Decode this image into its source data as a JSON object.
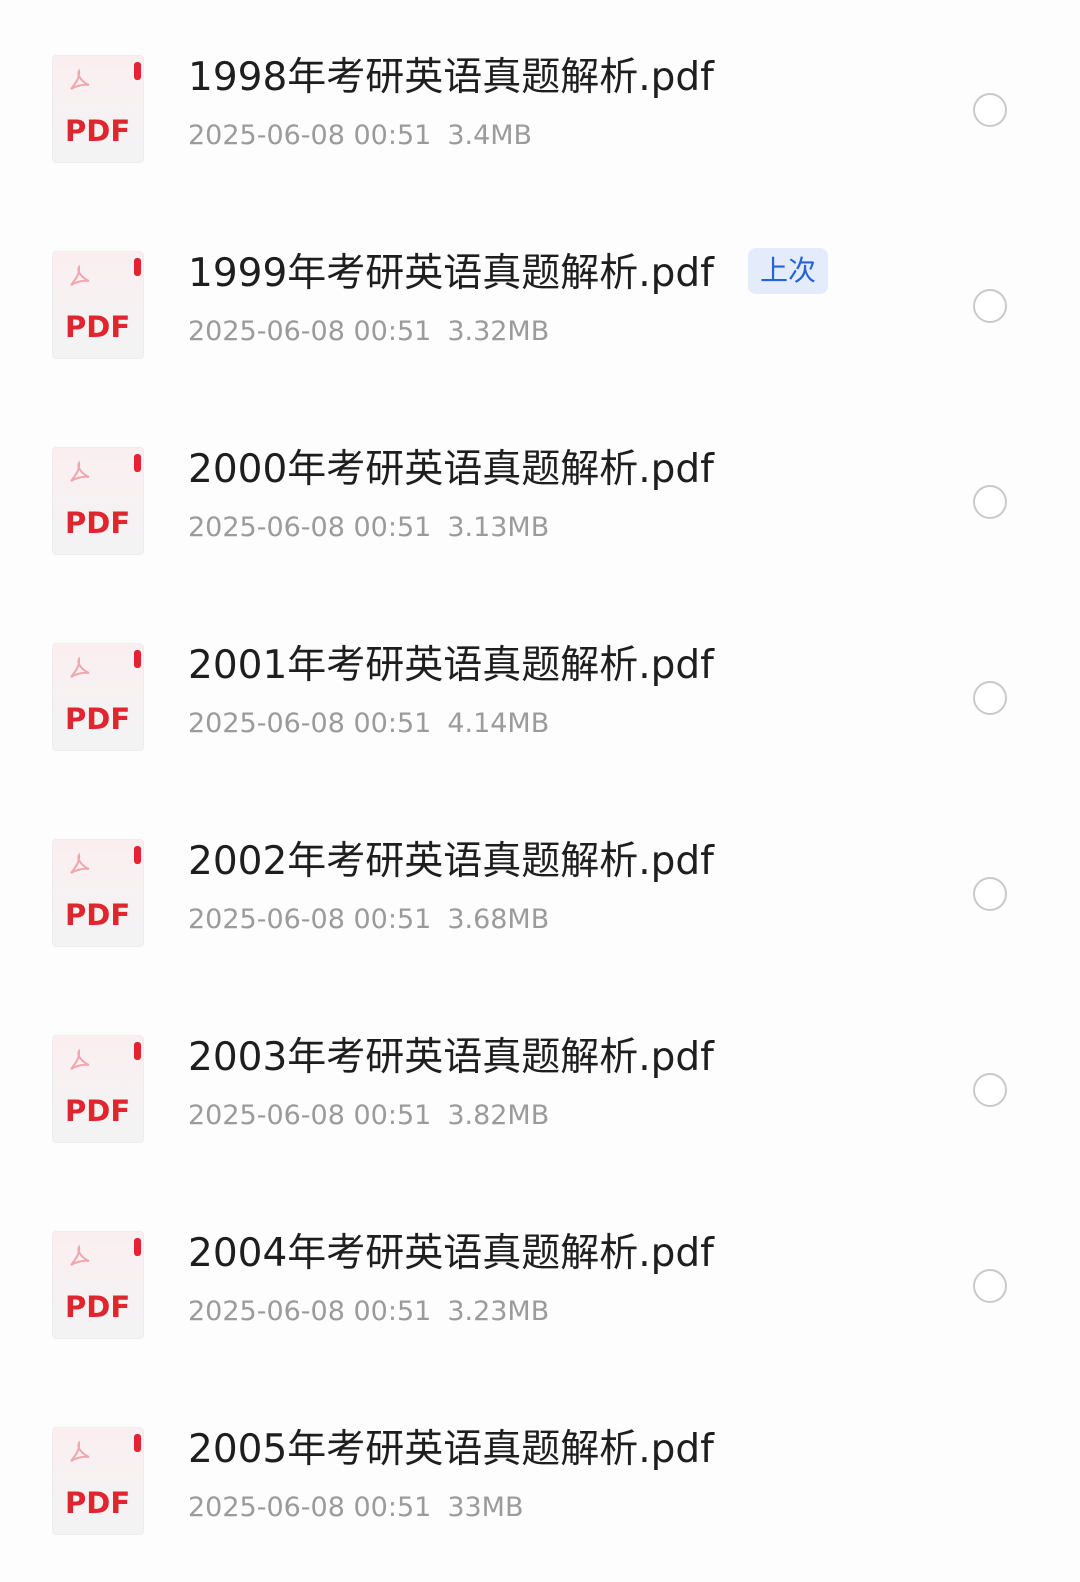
{
  "files": [
    {
      "name": "1998年考研英语真题解析.pdf",
      "date": "2025-06-08 00:51",
      "size": "3.4MB",
      "icon": "pdf-file-icon",
      "icon_label": "PDF",
      "badge": ""
    },
    {
      "name": "1999年考研英语真题解析.pdf",
      "date": "2025-06-08 00:51",
      "size": "3.32MB",
      "icon": "pdf-file-icon",
      "icon_label": "PDF",
      "badge": "上次"
    },
    {
      "name": "2000年考研英语真题解析.pdf",
      "date": "2025-06-08 00:51",
      "size": "3.13MB",
      "icon": "pdf-file-icon",
      "icon_label": "PDF",
      "badge": ""
    },
    {
      "name": "2001年考研英语真题解析.pdf",
      "date": "2025-06-08 00:51",
      "size": "4.14MB",
      "icon": "pdf-file-icon",
      "icon_label": "PDF",
      "badge": ""
    },
    {
      "name": "2002年考研英语真题解析.pdf",
      "date": "2025-06-08 00:51",
      "size": "3.68MB",
      "icon": "pdf-file-icon",
      "icon_label": "PDF",
      "badge": ""
    },
    {
      "name": "2003年考研英语真题解析.pdf",
      "date": "2025-06-08 00:51",
      "size": "3.82MB",
      "icon": "pdf-file-icon",
      "icon_label": "PDF",
      "badge": ""
    },
    {
      "name": "2004年考研英语真题解析.pdf",
      "date": "2025-06-08 00:51",
      "size": "3.23MB",
      "icon": "pdf-file-icon",
      "icon_label": "PDF",
      "badge": ""
    },
    {
      "name": "2005年考研英语真题解析.pdf",
      "date": "2025-06-08 00:51",
      "size": "33MB",
      "icon": "pdf-file-icon",
      "icon_label": "PDF",
      "badge": ""
    }
  ],
  "colors": {
    "pdf_red": "#e0252f",
    "badge_bg": "#e4ecfc",
    "badge_text": "#2365d8",
    "meta_text": "#9b9b9b",
    "title_text": "#1e1e1e"
  }
}
